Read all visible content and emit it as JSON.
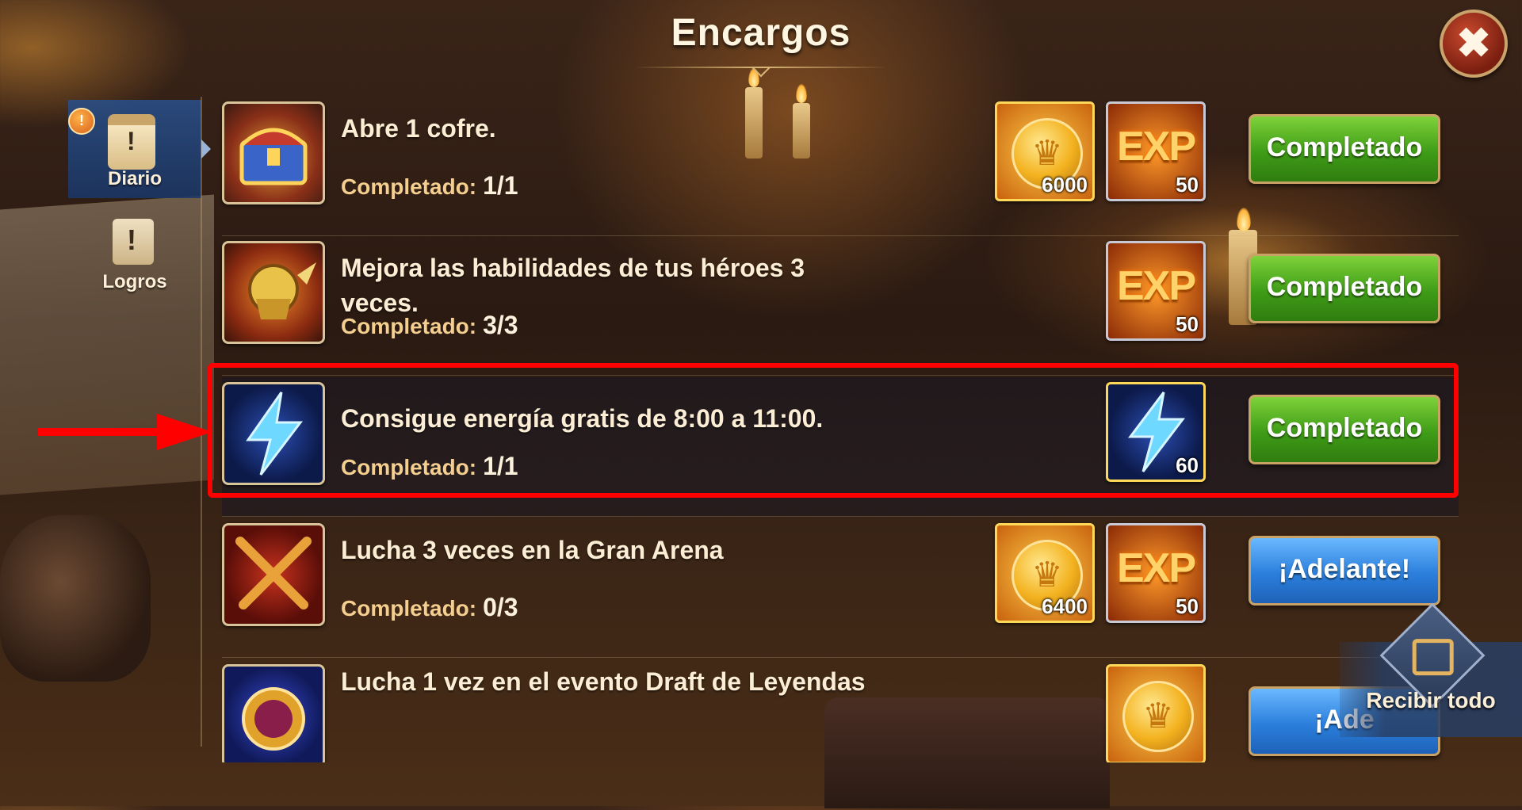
{
  "header": {
    "title": "Encargos"
  },
  "sidebar": {
    "tabs": [
      {
        "label": "Diario",
        "badge": "🎁"
      },
      {
        "label": "Logros"
      }
    ]
  },
  "quests": [
    {
      "description": "Abre 1 cofre.",
      "progress_label": "Completado:",
      "progress_value": "1/1",
      "rewards": [
        {
          "type": "coin-icon",
          "amount": "6000"
        },
        {
          "type": "exp-icon",
          "amount": "50"
        }
      ],
      "button": "Completado",
      "button_state": "completed"
    },
    {
      "description": "Mejora las habilidades de tus héroes 3 veces.",
      "progress_label": "Completado:",
      "progress_value": "3/3",
      "rewards": [
        {
          "type": "exp-icon",
          "amount": "50"
        }
      ],
      "button": "Completado",
      "button_state": "completed"
    },
    {
      "description": "Consigue energía gratis de 8:00 a 11:00.",
      "progress_label": "Completado:",
      "progress_value": "1/1",
      "rewards": [
        {
          "type": "energy-icon",
          "amount": "60"
        }
      ],
      "button": "Completado",
      "button_state": "completed"
    },
    {
      "description": "Lucha 3 veces en la Gran Arena",
      "progress_label": "Completado:",
      "progress_value": "0/3",
      "rewards": [
        {
          "type": "coin-icon",
          "amount": "6400"
        },
        {
          "type": "exp-icon",
          "amount": "50"
        }
      ],
      "button": "¡Adelante!",
      "button_state": "go"
    },
    {
      "description": "Lucha 1 vez en el evento Draft de Leyendas",
      "progress_label": "",
      "progress_value": "",
      "rewards": [
        {
          "type": "coin-icon",
          "amount": ""
        }
      ],
      "button": "¡Ade",
      "button_state": "go"
    }
  ],
  "claim_all": {
    "label": "Recibir todo"
  },
  "icons": {
    "close": "close-icon",
    "energy": "lightning-bolt-icon",
    "coin": "gold-coin-icon",
    "exp": "exp-icon"
  },
  "colors": {
    "complete_button": "#3f9c17",
    "go_button": "#2b7fdc",
    "highlight": "#ff0000"
  }
}
